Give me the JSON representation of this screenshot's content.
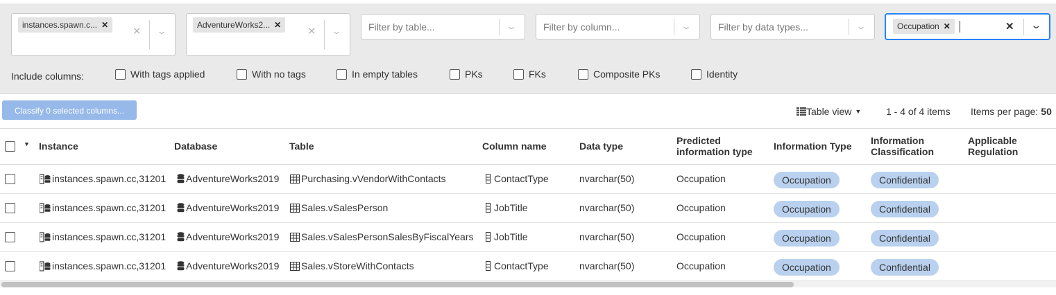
{
  "filters": {
    "instance": {
      "chip": "instances.spawn.c..."
    },
    "database": {
      "chip": "AdventureWorks2..."
    },
    "table": {
      "placeholder": "Filter by table..."
    },
    "column": {
      "placeholder": "Filter by column..."
    },
    "datatype": {
      "placeholder": "Filter by data types..."
    },
    "infotype": {
      "chip": "Occupation"
    }
  },
  "include": {
    "label": "Include columns:",
    "options": [
      "With tags applied",
      "With no tags",
      "In empty tables",
      "PKs",
      "FKs",
      "Composite PKs",
      "Identity"
    ]
  },
  "toolbar": {
    "classify_label": "Classify 0 selected columns...",
    "view_label": "Table view",
    "pager_info": "1 - 4 of 4 items",
    "items_per_page_label": "Items per page:",
    "items_per_page_value": "50"
  },
  "columns": {
    "instance": "Instance",
    "database": "Database",
    "table": "Table",
    "column_name": "Column name",
    "data_type": "Data type",
    "predicted_1": "Predicted",
    "predicted_2": "information type",
    "information_type": "Information Type",
    "classification_1": "Information",
    "classification_2": "Classification",
    "regulation_1": "Applicable",
    "regulation_2": "Regulation"
  },
  "rows": [
    {
      "instance": "instances.spawn.cc,31201",
      "database": "AdventureWorks2019",
      "table": "Purchasing.vVendorWithContacts",
      "column": "ContactType",
      "data_type": "nvarchar(50)",
      "predicted": "Occupation",
      "info_type": "Occupation",
      "classification": "Confidential"
    },
    {
      "instance": "instances.spawn.cc,31201",
      "database": "AdventureWorks2019",
      "table": "Sales.vSalesPerson",
      "column": "JobTitle",
      "data_type": "nvarchar(50)",
      "predicted": "Occupation",
      "info_type": "Occupation",
      "classification": "Confidential"
    },
    {
      "instance": "instances.spawn.cc,31201",
      "database": "AdventureWorks2019",
      "table": "Sales.vSalesPersonSalesByFiscalYears",
      "column": "JobTitle",
      "data_type": "nvarchar(50)",
      "predicted": "Occupation",
      "info_type": "Occupation",
      "classification": "Confidential"
    },
    {
      "instance": "instances.spawn.cc,31201",
      "database": "AdventureWorks2019",
      "table": "Sales.vStoreWithContacts",
      "column": "ContactType",
      "data_type": "nvarchar(50)",
      "predicted": "Occupation",
      "info_type": "Occupation",
      "classification": "Confidential"
    }
  ],
  "colors": {
    "accent": "#2684ff",
    "pill": "#b9d1ef",
    "button": "#96b9e9"
  },
  "icons": {
    "instance": "server-icon",
    "database": "database-icon",
    "table": "table-icon",
    "column": "column-icon"
  }
}
